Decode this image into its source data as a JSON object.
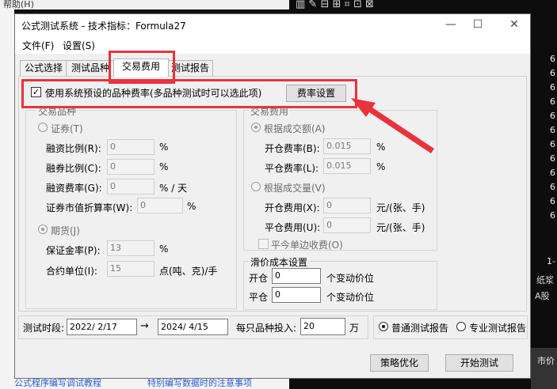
{
  "background": {
    "top_menu_hint": "帮助(H)",
    "bottom_link_1": "公式程序编写调试教程",
    "bottom_link_2": "特别编写数据时的注意事项",
    "right_labels": [
      "纸浆",
      "A股",
      "市价"
    ],
    "right_numbers": [
      "6",
      "6",
      "6",
      "6",
      "6",
      "6",
      "6",
      "6",
      "6",
      "6",
      "6",
      "6",
      "1-"
    ]
  },
  "window": {
    "title": "公式测试系统 - 技术指标：Formula27",
    "minimize": "—",
    "maximize": "☐",
    "close": "✕"
  },
  "menu": {
    "file": "文件(F)",
    "settings": "设置(S)"
  },
  "tabs": [
    "公式选择",
    "测试品种",
    "交易费用",
    "测试报告"
  ],
  "active_tab": "交易费用",
  "use_default_rate": {
    "checked": true,
    "label": "使用系统预设的品种费率(多品种测试时可以选此项)",
    "button": "费率设置"
  },
  "variety": {
    "title": "交易品种",
    "securities": {
      "label": "证券(T)",
      "fields": [
        {
          "label": "融资比例(R):",
          "value": "0",
          "unit": "%"
        },
        {
          "label": "融券比例(C):",
          "value": "0",
          "unit": "%"
        },
        {
          "label": "融资费率(G):",
          "value": "0",
          "unit": "% / 天"
        },
        {
          "label": "证券市值折算率(W):",
          "value": "0",
          "unit": "%"
        }
      ]
    },
    "futures": {
      "label": "期货(J)",
      "fields": [
        {
          "label": "保证金率(P):",
          "value": "13",
          "unit": "%"
        },
        {
          "label": "合约单位(I):",
          "value": "15",
          "unit": "点(吨、克)/手"
        }
      ]
    }
  },
  "fees": {
    "title": "交易费用",
    "by_amount": {
      "label": "根据成交额(A)",
      "fields": [
        {
          "label": "开仓费率(B):",
          "value": "0.015",
          "unit": "%"
        },
        {
          "label": "平仓费率(L):",
          "value": "0.015",
          "unit": "%"
        }
      ]
    },
    "by_volume": {
      "label": "根据成交量(V)",
      "fields": [
        {
          "label": "开仓费用(X):",
          "value": "0",
          "unit": "元/(张、手)"
        },
        {
          "label": "平仓费用(U):",
          "value": "0",
          "unit": "元/(张、手)"
        }
      ]
    },
    "close_today": "平今单边收费(O)"
  },
  "slippage": {
    "title": "滑价成本设置",
    "open_label": "开仓",
    "open_value": "0",
    "open_unit": "个变动价位",
    "close_label": "平仓",
    "close_value": "0",
    "close_unit": "个变动价位"
  },
  "bottom": {
    "period_label": "测试时段:",
    "start_date": "2022/ 2/17",
    "arrow": "→",
    "end_date": "2024/ 4/15",
    "invest_label": "每只品种投入:",
    "invest_value": "20",
    "invest_unit": "万",
    "report_normal": "普通测试报告",
    "report_pro": "专业测试报告",
    "optimize_button": "策略优化",
    "start_button": "开始测试"
  },
  "colors": {
    "annotation_red": "#e8333c"
  }
}
